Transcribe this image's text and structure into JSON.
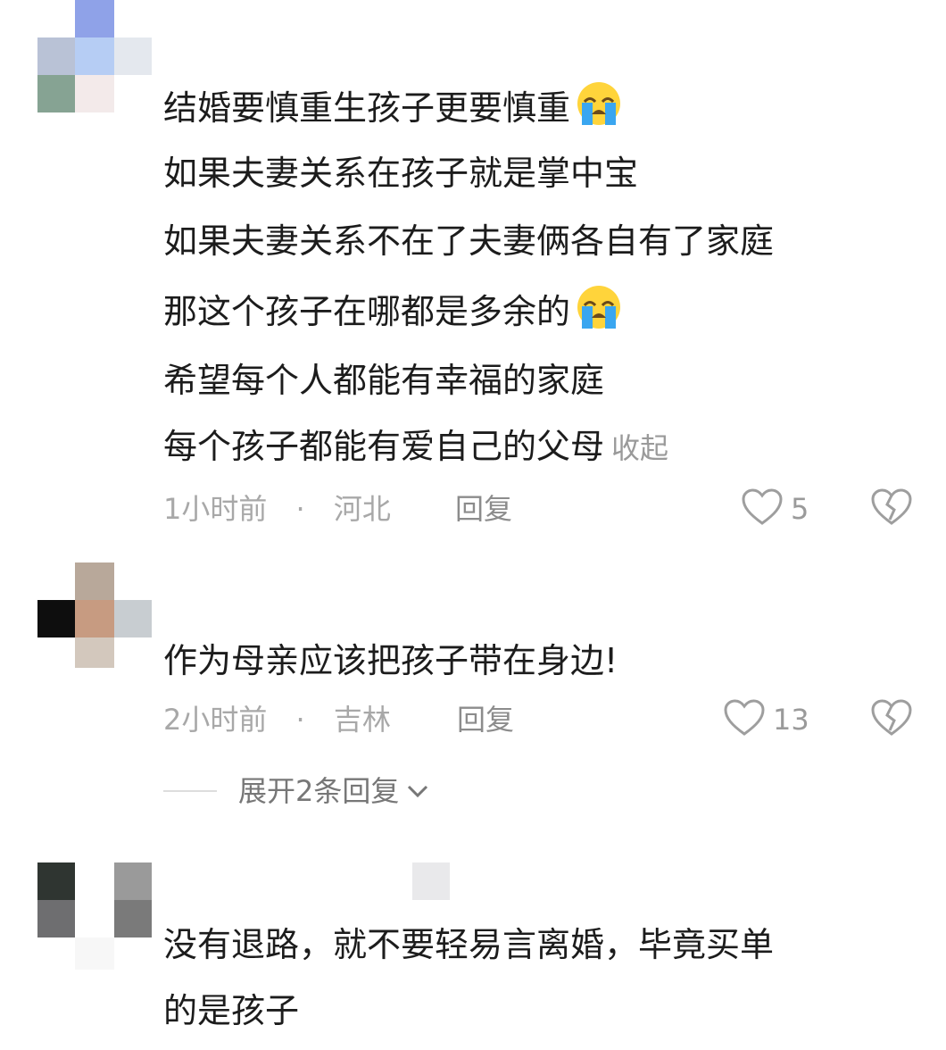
{
  "comments": [
    {
      "lines": [
        "结婚要慎重生孩子更要慎重",
        "如果夫妻关系在孩子就是掌中宝",
        "如果夫妻关系不在了夫妻俩各自有了家庭",
        "那这个孩子在哪都是多余的",
        "希望每个人都能有幸福的家庭",
        "每个孩子都能有爱自己的父母"
      ],
      "collapse_label": "收起",
      "time": "1小时前",
      "separator": "·",
      "location": "河北",
      "reply_label": "回复",
      "likes": "5"
    },
    {
      "lines": [
        "作为母亲应该把孩子带在身边!"
      ],
      "time": "2小时前",
      "separator": "·",
      "location": "吉林",
      "reply_label": "回复",
      "likes": "13",
      "expand_label": "展开2条回复"
    },
    {
      "lines": [
        "没有退路，就不要轻易言离婚，毕竟买单",
        "的是孩子"
      ]
    }
  ],
  "colors": {
    "emoji_face": "#ffd43b",
    "emoji_tear": "#3aa6f0",
    "heart": "#9e9e9e"
  }
}
